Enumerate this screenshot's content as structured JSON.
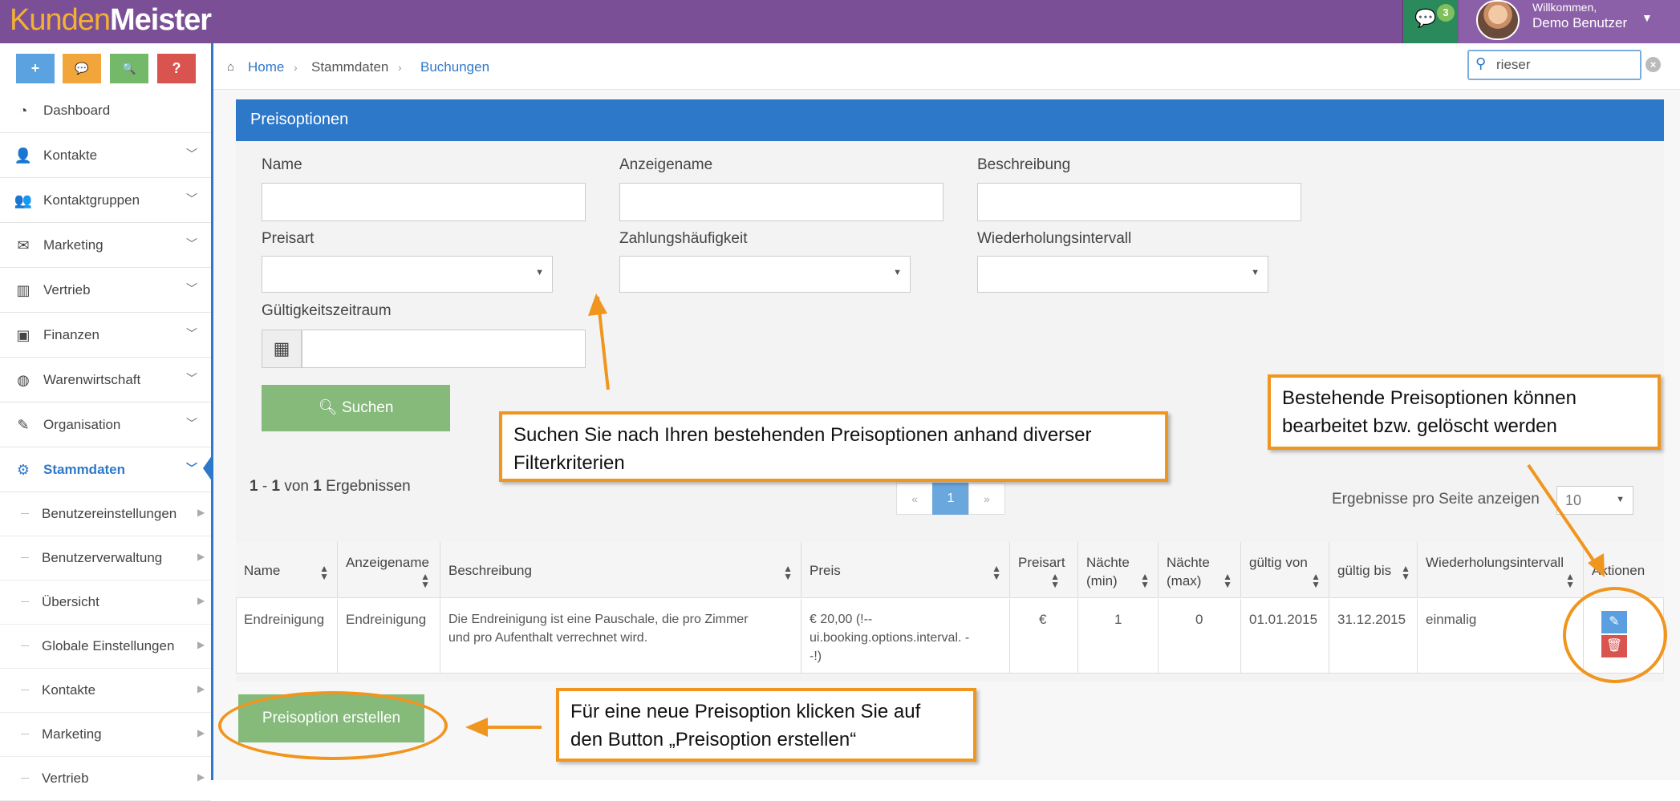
{
  "brand": {
    "part1": "Kunden",
    "part2": "Meister"
  },
  "header": {
    "chat_count": "3",
    "welcome_line1": "Willkommen,",
    "welcome_line2": "Demo Benutzer"
  },
  "quick_buttons": [
    {
      "icon": "plus-icon",
      "glyph": "+",
      "color": "#5aa3e0"
    },
    {
      "icon": "chat-icon",
      "glyph": "💬",
      "color": "#f2a53a"
    },
    {
      "icon": "search-icon",
      "glyph": "🔍",
      "color": "#74b86a"
    },
    {
      "icon": "help-icon",
      "glyph": "?",
      "color": "#d9534f"
    }
  ],
  "sidebar": {
    "items": [
      {
        "label": "Dashboard",
        "icon": "dashboard-icon"
      },
      {
        "label": "Kontakte",
        "icon": "user-icon"
      },
      {
        "label": "Kontaktgruppen",
        "icon": "users-icon"
      },
      {
        "label": "Marketing",
        "icon": "envelope-icon"
      },
      {
        "label": "Vertrieb",
        "icon": "bar-chart-icon"
      },
      {
        "label": "Finanzen",
        "icon": "money-icon"
      },
      {
        "label": "Warenwirtschaft",
        "icon": "globe-icon"
      },
      {
        "label": "Organisation",
        "icon": "edit-icon"
      },
      {
        "label": "Stammdaten",
        "icon": "cogs-icon"
      }
    ],
    "subitems": [
      "Benutzereinstellungen",
      "Benutzerverwaltung",
      "Übersicht",
      "Globale Einstellungen",
      "Kontakte",
      "Marketing",
      "Vertrieb"
    ]
  },
  "breadcrumb": {
    "home": "Home",
    "level1": "Stammdaten",
    "level2": "Buchungen"
  },
  "search": {
    "value": "rieser"
  },
  "panel": {
    "title": "Preisoptionen",
    "labels": {
      "name": "Name",
      "displayname": "Anzeigename",
      "description": "Beschreibung",
      "pricetype": "Preisart",
      "payfreq": "Zahlungshäufigkeit",
      "repeat": "Wiederholungsintervall",
      "validity": "Gültigkeitszeitraum"
    },
    "search_button": "Suchen"
  },
  "results": {
    "count_from": "1",
    "count_to": "1",
    "count_total": "1",
    "of_word": "von",
    "results_word": "Ergebnissen",
    "per_page_label": "Ergebnisse pro Seite anzeigen",
    "per_page_value": "10",
    "pager": {
      "prev": "«",
      "current": "1",
      "next": "»"
    }
  },
  "table": {
    "columns": [
      "Name",
      "Anzeigename",
      "Beschreibung",
      "Preis",
      "Preisart",
      "Nächte (min)",
      "Nächte (max)",
      "gültig von",
      "gültig bis",
      "Wiederholungsintervall",
      "Aktionen"
    ],
    "columns_line1": [
      "Name",
      "Anzeigename",
      "Beschreibung",
      "Preis",
      "Preisart",
      "Nächte",
      "Nächte",
      "gültig von",
      "gültig bis",
      "Wiederholungsintervall",
      "Aktionen"
    ],
    "columns_line2": [
      "",
      "",
      "",
      "",
      "",
      "(min)",
      "(max)",
      "",
      "",
      "",
      ""
    ],
    "row": {
      "name": "Endreinigung",
      "displayname": "Endreinigung",
      "description_l1": "Die Endreinigung ist eine Pauschale, die pro Zimmer",
      "description_l2": "und pro Aufenthalt verrechnet wird.",
      "price_l1": "€ 20,00 (!--",
      "price_l2": "ui.booking.options.interval. -",
      "price_l3": "-!)",
      "pricetype": "€",
      "nights_min": "1",
      "nights_max": "0",
      "valid_from": "01.01.2015",
      "valid_to": "31.12.2015",
      "repeat": "einmalig"
    }
  },
  "create_button": "Preisoption erstellen",
  "callouts": {
    "search_l1": "Suchen Sie nach Ihren bestehenden  Preisoptionen anhand diverser",
    "search_l2": "Filterkriterien",
    "edit_l1": "Bestehende Preisoptionen können",
    "edit_l2": "bearbeitet  bzw. gelöscht werden",
    "create_l1": "Für eine neue Preisoption klicken Sie auf",
    "create_l2": "den Button „Preisoption erstellen“"
  },
  "colors": {
    "topbar": "#7b4f96",
    "accent": "#2d78c8",
    "green": "#85ba7b",
    "callout": "#f0951e"
  }
}
